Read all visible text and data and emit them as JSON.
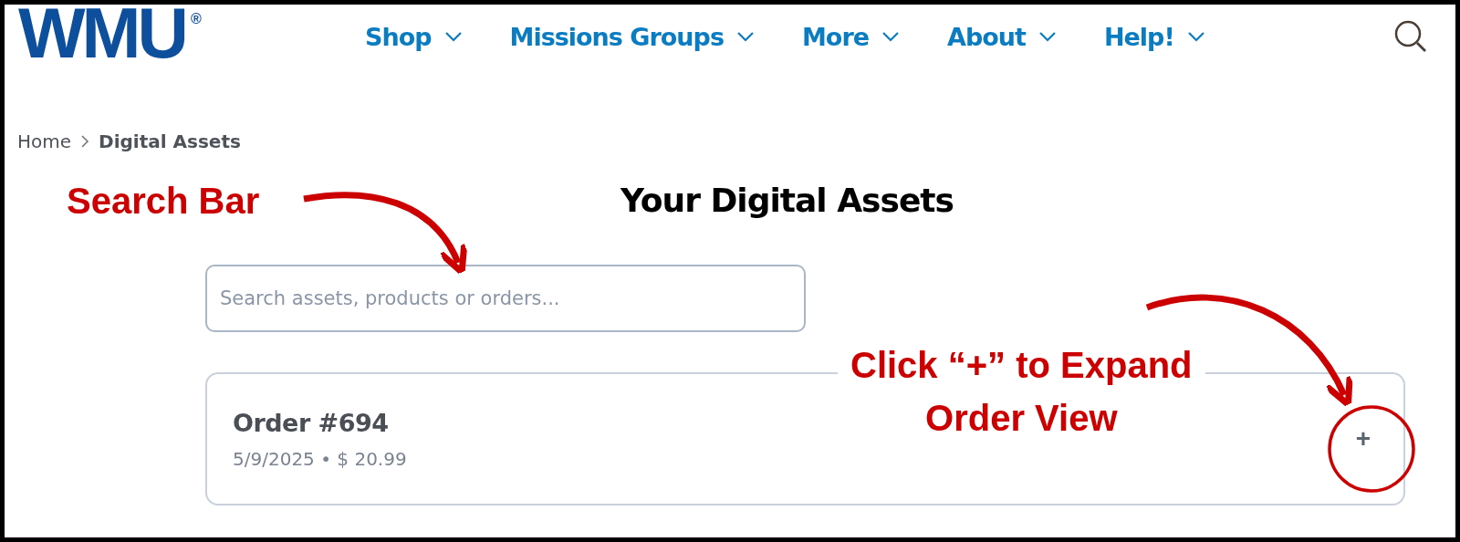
{
  "logo": {
    "text": "WMU",
    "mark": "®"
  },
  "nav": [
    {
      "label": "Shop"
    },
    {
      "label": "Missions Groups"
    },
    {
      "label": "More"
    },
    {
      "label": "About"
    },
    {
      "label": "Help!"
    }
  ],
  "breadcrumb": [
    {
      "label": "Home"
    },
    {
      "label": "Digital Assets"
    }
  ],
  "title": "Your Digital Assets",
  "search": {
    "placeholder": "Search assets, products or orders..."
  },
  "orders": [
    {
      "title": "Order #694",
      "meta": "5/9/2025 • $ 20.99",
      "toggle": "+"
    }
  ],
  "annotations": [
    {
      "kind": "label",
      "lines": [
        "Search Bar"
      ]
    },
    {
      "kind": "callout",
      "lines": [
        "Click “+” to Expand",
        "Order View"
      ]
    }
  ]
}
